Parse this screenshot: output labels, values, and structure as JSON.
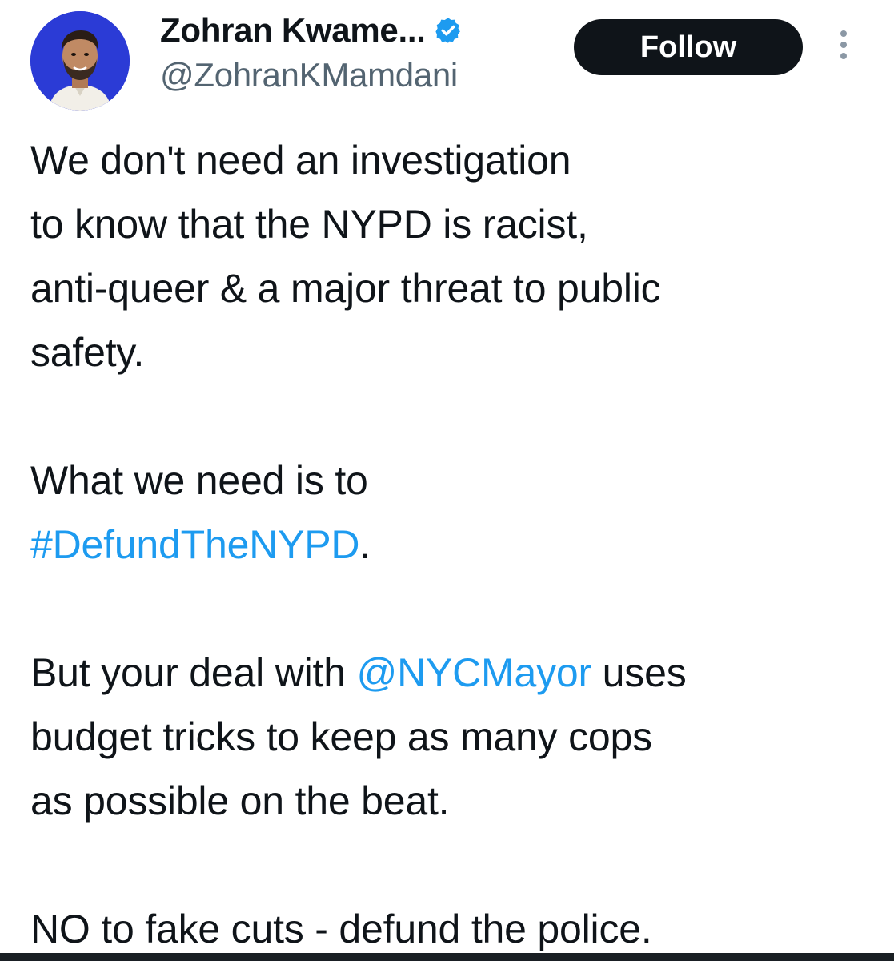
{
  "author": {
    "display_name": "Zohran Kwame...",
    "handle": "@ZohranKMamdani",
    "verified_icon": "verified-badge-icon",
    "avatar_bg": "#2b3bd6"
  },
  "actions": {
    "follow_label": "Follow",
    "more_icon": "more-vertical-icon"
  },
  "tweet": {
    "p1_line1": "We don't need an investigation",
    "p1_line2": "to know that the NYPD is racist,",
    "p1_line3": "anti-queer & a major threat to public",
    "p1_line4": "safety.",
    "p2_line1": "What we need is to",
    "p2_hashtag": "#DefundTheNYPD",
    "p2_end": ".",
    "p3_start": "But your deal with ",
    "p3_mention": "@NYCMayor",
    "p3_rest": " uses",
    "p3_line2": "budget tricks to keep as many cops",
    "p3_line3": "as possible on the beat.",
    "p4": "NO to fake cuts - defund the police."
  },
  "colors": {
    "link": "#1d9bf0",
    "text": "#0f1419",
    "secondary": "#536471",
    "follow_bg": "#0f1419"
  }
}
